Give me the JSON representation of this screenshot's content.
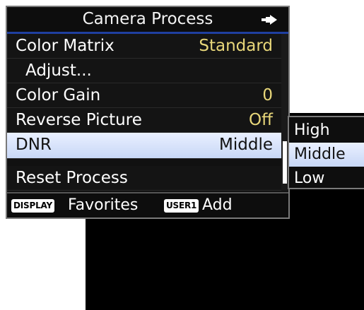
{
  "menu": {
    "title": "Camera Process",
    "back_icon": "return-arrow-icon",
    "items": [
      {
        "label": "Color Matrix",
        "value": "Standard"
      },
      {
        "label": "Adjust...",
        "value": ""
      },
      {
        "label": "Color Gain",
        "value": "0"
      },
      {
        "label": "Reverse Picture",
        "value": "Off"
      },
      {
        "label": "DNR",
        "value": "Middle",
        "selected": true
      },
      {
        "label": "Reset Process",
        "value": ""
      }
    ]
  },
  "footer": {
    "display_key": "DISPLAY",
    "display_action": "Favorites",
    "user_key": "USER1",
    "user_action": "Add"
  },
  "dropdown": {
    "options": [
      "High",
      "Middle",
      "Low"
    ],
    "selected": "Middle"
  },
  "colors": {
    "value_text": "#e8d77a",
    "highlight": "#dbe6fb",
    "header_rule": "#1f3fa0"
  }
}
